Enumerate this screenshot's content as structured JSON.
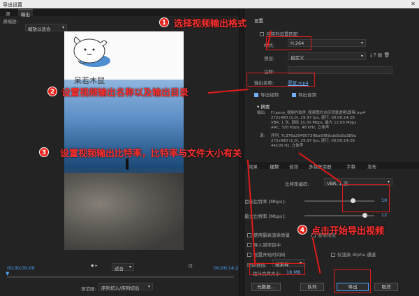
{
  "window": {
    "title": "导出设置",
    "close": "✕"
  },
  "left": {
    "tabs": [
      "源",
      "输出"
    ],
    "source_scale_label": "源缩放:",
    "source_scale_value": "缩放以适合",
    "overlay_text": "呆若木鼠",
    "timecode_start": "00;00;00;00",
    "timecode_end": "00;00;14;28",
    "fit_value": "适合",
    "source_range_label": "源范围:",
    "source_range_value": "序列切入/序列切出",
    "playback_fill_fraction": 0.0
  },
  "right": {
    "header_suffix": "设置",
    "match_sequence": "与序列设置匹配",
    "format_label": "格式:",
    "format_value": "H.264",
    "preset_label": "预设:",
    "preset_value": "自定义",
    "comment_label": "注释:",
    "output_name_label": "输出名称:",
    "output_name_value": "厚冥.mp4",
    "export_video": "导出视频",
    "export_audio": "导出音频",
    "summary_title": "摘要",
    "summary_output_label": "输出:",
    "summary_output": [
      "F:\\anne_视制作软件_视频图片水印背景透明\\厚冥.mp4",
      "272x480 (1.0), 29.97 fps, 逐行, 00;00;14;28",
      "VBR, 1 次, 目标 10.00 Mbps, 最大 12.00 Mbps",
      "AAC, 320 Kbps, 48 kHz, 立体声"
    ],
    "summary_source_label": "源:",
    "summary_source": [
      "序列, 7c376a2949573f6be5f89cda5d0d389a",
      "272x480 (1.0), 29.97 fps, 逐行, 00;00;14;28",
      "44100 Hz, 立体声"
    ],
    "tabs": [
      "效果",
      "视频",
      "音频",
      "多路复用器",
      "字幕",
      "发布"
    ],
    "bitrate_encoding_label": "比特率编码:",
    "bitrate_encoding_value": "VBR, 1 次",
    "target_bitrate_label": "目标比特率 [Mbps]:",
    "target_bitrate_value": "10",
    "max_bitrate_label": "最大比特率 [Mbps]:",
    "max_bitrate_value": "12",
    "use_max_render": "使用最高渲染质量",
    "use_preview": "使用预览",
    "import_project": "导入到项目中",
    "set_start_timecode": "设置开始时间码",
    "render_alpha_only": "仅渲染 Alpha 通道",
    "time_interp_label": "时间插值:",
    "time_interp_value": "帧采样",
    "est_size_label": "估计文件大小:",
    "est_size_value": "18 MB",
    "btn_metadata": "元数据...",
    "btn_queue": "队列",
    "btn_export": "导出",
    "btn_cancel": "取消"
  },
  "annotations": [
    {
      "num": "1",
      "text": "选择视频输出格式"
    },
    {
      "num": "2",
      "text": "设置视频输出名称以及输出目录"
    },
    {
      "num": "3",
      "text": "设置视频输出比特率，比特率与文件大小有关"
    },
    {
      "num": "4",
      "text": "点击开始导出视频"
    }
  ],
  "colors": {
    "annotation_red": "#e01b1b",
    "accent_blue": "#6fb0ff"
  }
}
